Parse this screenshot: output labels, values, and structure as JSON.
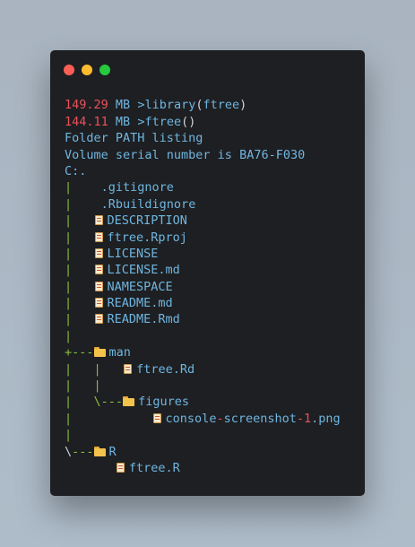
{
  "window": {
    "buttons": [
      "close",
      "minimize",
      "maximize"
    ]
  },
  "prompt1": {
    "mem": "149.29",
    "unit": "MB",
    "gt": ">",
    "fn": "library",
    "open": "(",
    "arg": "ftree",
    "close": ")"
  },
  "prompt2": {
    "mem": "144.11",
    "unit": "MB",
    "gt": ">",
    "fn": "ftree",
    "parens": "()"
  },
  "output": {
    "header": "Folder PATH listing",
    "serial": "Volume serial number is BA76-F030",
    "root": "C:."
  },
  "tree": {
    "gitignore": ".gitignore",
    "rbuildignore": ".Rbuildignore",
    "description": "DESCRIPTION",
    "rproj": "ftree.Rproj",
    "license": "LICENSE",
    "license_md": "LICENSE.md",
    "namespace": "NAMESPACE",
    "readme_md": "README.md",
    "readme_rmd": "README.Rmd",
    "man": "man",
    "man_rd": "ftree.Rd",
    "figures": "figures",
    "png_a": "console",
    "png_b": "-",
    "png_c": "screenshot",
    "png_d": "-",
    "png_e": "1",
    "png_f": ".png",
    "r_dir": "R",
    "r_file": "ftree.R"
  },
  "glyphs": {
    "pipe": "|",
    "plus_branch": "+---",
    "plus": "+",
    "dashes": "---",
    "backslash": "\\"
  },
  "icons": {
    "file": "file-icon",
    "folder": "folder-icon"
  },
  "colors": {
    "background": "#aebcc9",
    "terminal": "#1e1f22",
    "text": "#6fb6e0",
    "memory": "#e8525b",
    "tree": "#8bbf3f",
    "close": "#ff5f56",
    "minimize": "#ffbd2e",
    "maximize": "#27c93f"
  }
}
